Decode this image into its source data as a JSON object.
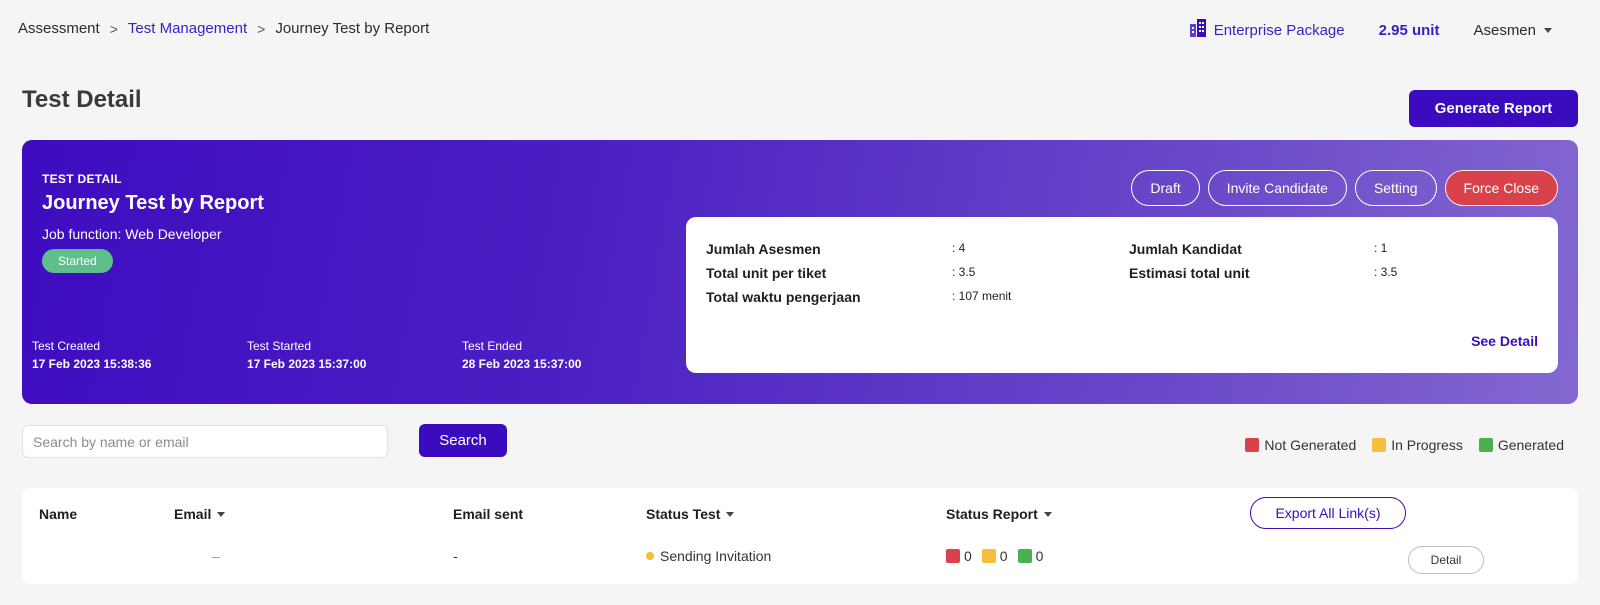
{
  "breadcrumb": {
    "items": [
      "Assessment",
      "Test Management",
      "Journey Test by Report"
    ],
    "separator": ">"
  },
  "header": {
    "package": "Enterprise Package",
    "units": "2.95 unit",
    "user": "Asesmen"
  },
  "page": {
    "title": "Test Detail",
    "generate_report": "Generate Report"
  },
  "hero": {
    "eyebrow": "TEST DETAIL",
    "name": "Journey Test by Report",
    "job_function": "Job function: Web Developer",
    "status": "Started",
    "dates": [
      {
        "label": "Test Created",
        "value": "17 Feb 2023 15:38:36"
      },
      {
        "label": "Test Started",
        "value": "17 Feb 2023 15:37:00"
      },
      {
        "label": "Test Ended",
        "value": "28 Feb 2023 15:37:00"
      }
    ],
    "actions": [
      "Draft",
      "Invite Candidate",
      "Setting",
      "Force Close"
    ],
    "summary": {
      "jumlah_asesmen_label": "Jumlah Asesmen",
      "jumlah_asesmen_value": ": 4",
      "unit_per_tiket_label": "Total unit per tiket",
      "unit_per_tiket_value": ": 3.5",
      "waktu_label": "Total waktu pengerjaan",
      "waktu_value": ": 107 menit",
      "kandidat_label": "Jumlah Kandidat",
      "kandidat_value": ": 1",
      "estimasi_label": "Estimasi total unit",
      "estimasi_value": ": 3.5",
      "see_detail": "See Detail"
    }
  },
  "search": {
    "placeholder": "Search by name or email",
    "button": "Search"
  },
  "legend": {
    "items": [
      {
        "label": "Not Generated",
        "color": "#d9424a"
      },
      {
        "label": "In Progress",
        "color": "#f5be3b"
      },
      {
        "label": "Generated",
        "color": "#4caf50"
      }
    ]
  },
  "table": {
    "columns": [
      "Name",
      "Email",
      "Email sent",
      "Status Test",
      "Status Report"
    ],
    "export_button": "Export All Link(s)",
    "rows": [
      {
        "name": "",
        "email": "_",
        "email_sent": "-",
        "status_test": "Sending Invitation",
        "report_counts": [
          "0",
          "0",
          "0"
        ],
        "action": "Detail"
      }
    ]
  },
  "colors": {
    "brand": "#3a0bbf",
    "danger": "#d9424a",
    "started": "#5fbf8a"
  }
}
